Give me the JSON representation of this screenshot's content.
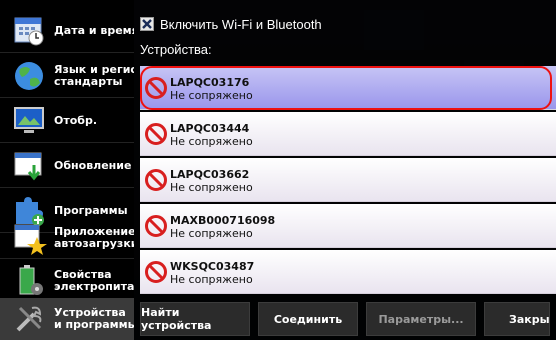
{
  "sidebar": {
    "items": [
      {
        "label": "Дата и время",
        "icon": "calendar-clock-icon"
      },
      {
        "label": "Язык и регио\nстандарты",
        "icon": "globe-icon"
      },
      {
        "label": "Отобр.",
        "icon": "display-icon"
      },
      {
        "label": "Обновление",
        "icon": "update-icon"
      },
      {
        "label": "Программы",
        "icon": "puzzle-icon"
      },
      {
        "label": "Приложение\nавтозагрузки",
        "icon": "startup-star-icon"
      },
      {
        "label": "Свойства\nэлектропита",
        "icon": "battery-icon"
      },
      {
        "label": "Устройства\nи программы",
        "icon": "tools-icon"
      }
    ]
  },
  "panel": {
    "toggle_label": "Включить Wi-Fi и Bluetooth",
    "toggle_checked": true,
    "devices_label": "Устройства:",
    "devices": [
      {
        "name": "LAPQC03176",
        "status": "Не сопряжено",
        "selected": true
      },
      {
        "name": "LAPQC03444",
        "status": "Не сопряжено",
        "selected": false
      },
      {
        "name": "LAPQC03662",
        "status": "Не сопряжено",
        "selected": false
      },
      {
        "name": "MAXB000716098",
        "status": "Не сопряжено",
        "selected": false
      },
      {
        "name": "WKSQC03487",
        "status": "Не сопряжено",
        "selected": false
      }
    ],
    "buttons": {
      "find": "Найти устройства",
      "connect": "Соединить",
      "params": "Параметры...",
      "close": "Закрыть"
    }
  },
  "colors": {
    "selected_bg": "#9a96ec",
    "highlight_ring": "#e11111",
    "ban_red": "#d81f1f"
  }
}
